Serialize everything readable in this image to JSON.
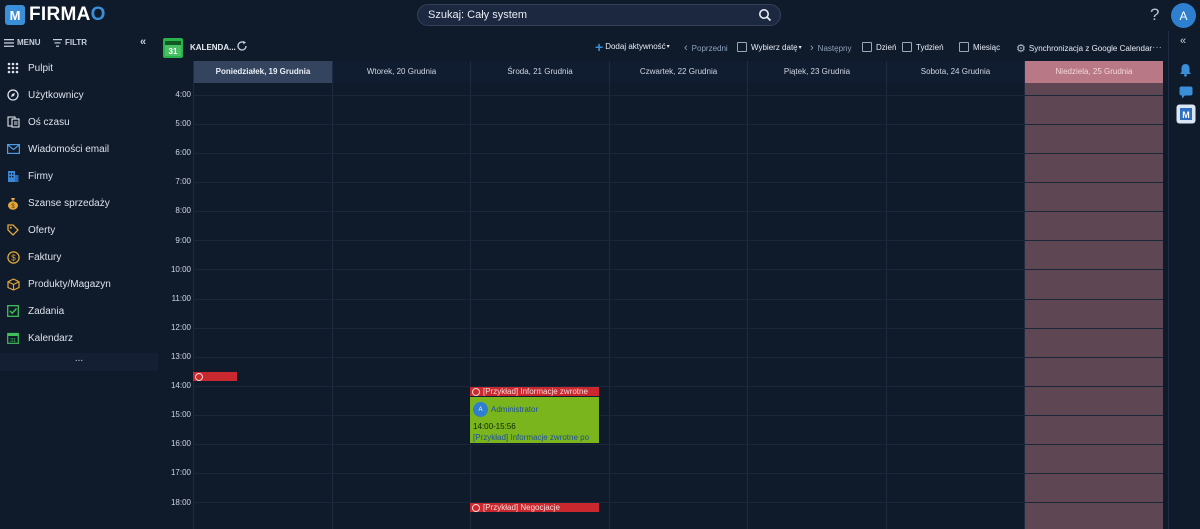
{
  "app": {
    "logo_text": "FIRMA",
    "logo_o": "O",
    "logo_mark": "M"
  },
  "search": {
    "label": "Szukaj: Cały system"
  },
  "header": {
    "help": "?",
    "avatar": "A"
  },
  "sidebar": {
    "menu_label": "MENU",
    "filter_label": "FILTR",
    "collapse": "«",
    "items": [
      {
        "label": "Pulpit",
        "icon": "grid-icon"
      },
      {
        "label": "Użytkownicy",
        "icon": "compass-icon"
      },
      {
        "label": "Oś czasu",
        "icon": "timeline-icon"
      },
      {
        "label": "Wiadomości email",
        "icon": "mail-icon"
      },
      {
        "label": "Firmy",
        "icon": "building-icon"
      },
      {
        "label": "Szanse sprzedaży",
        "icon": "money-bag-icon"
      },
      {
        "label": "Oferty",
        "icon": "tag-icon"
      },
      {
        "label": "Faktury",
        "icon": "dollar-icon"
      },
      {
        "label": "Produkty/Magazyn",
        "icon": "box-icon"
      },
      {
        "label": "Zadania",
        "icon": "checkbox-icon"
      },
      {
        "label": "Kalendarz",
        "icon": "calendar-icon"
      }
    ],
    "more": "..."
  },
  "toolbar": {
    "calendar_icon": "31",
    "title": "KALENDA...",
    "add_activity": "Dodaj aktywność",
    "previous": "Poprzedni",
    "choose_date": "Wybierz datę",
    "next": "Następny",
    "day": "Dzień",
    "week": "Tydzień",
    "month": "Miesiąc",
    "google_sync": "Synchronizacja z Google Calendar",
    "more": "···"
  },
  "calendar": {
    "days": [
      "Poniedziałek, 19 Grudnia",
      "Wtorek, 20 Grudnia",
      "Środa, 21 Grudnia",
      "Czwartek, 22 Grudnia",
      "Piątek, 23 Grudnia",
      "Sobota, 24 Grudnia",
      "Niedziela, 25 Grudnia"
    ],
    "hours": [
      "4:00",
      "5:00",
      "6:00",
      "7:00",
      "8:00",
      "9:00",
      "10:00",
      "11:00",
      "12:00",
      "13:00",
      "14:00",
      "15:00",
      "16:00",
      "17:00",
      "18:00"
    ],
    "events": {
      "ev1_title": "[Przykład] Informacje zwrotne",
      "ev1_user": "Administrator",
      "ev1_user_initial": "A",
      "ev1_time": "14:00-15:56",
      "ev1_desc": "[Przykład] Informacje zwrotne po",
      "ev2_title": "[Przykład] Negocjacje"
    }
  },
  "rightbar": {
    "collapse": "«"
  },
  "colors": {
    "background": "#0f1a2b",
    "sunday": "#5e4653",
    "event_red": "#c9282f",
    "event_green": "#7ab51d",
    "accent": "#2f7fd0"
  }
}
